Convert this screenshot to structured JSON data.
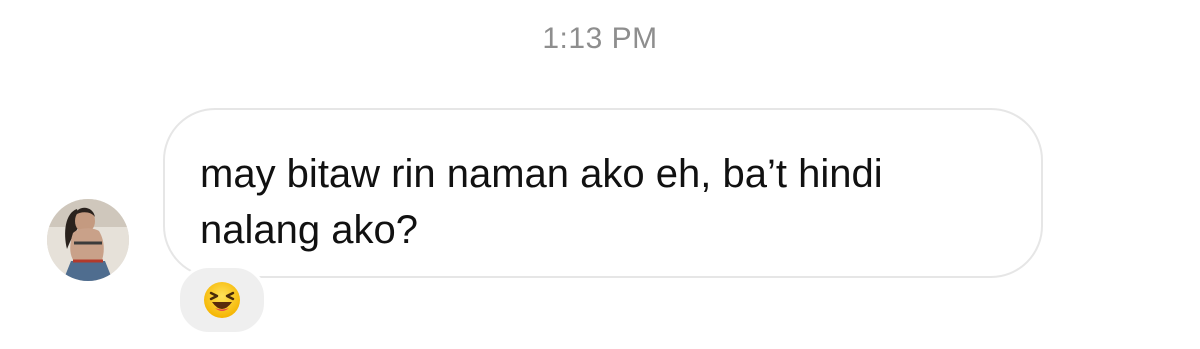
{
  "chat": {
    "timestamp": "1:13 PM",
    "message": {
      "text": "may bitaw rin naman ako eh, ba’t hindi\nnalang ako?",
      "sender_avatar_icon": "profile-photo",
      "reaction": {
        "emoji": "😆",
        "icon": "laughing-face-emoji-icon"
      }
    }
  }
}
